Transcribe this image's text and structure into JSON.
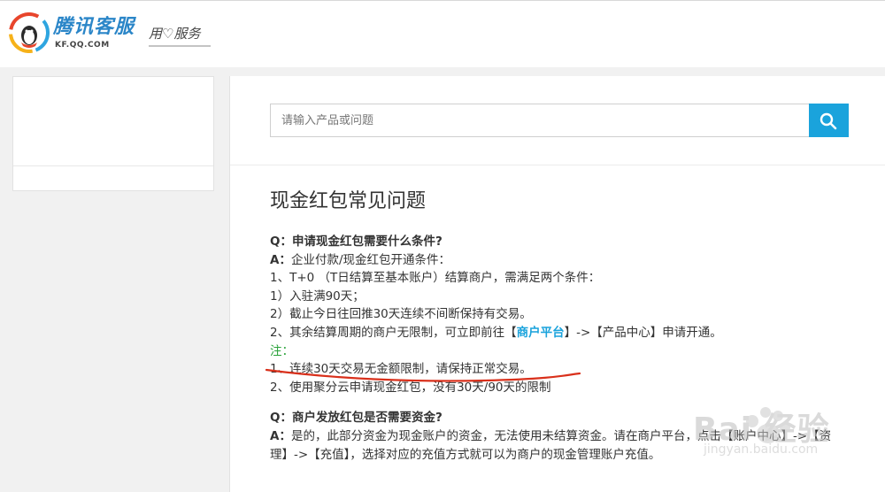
{
  "header": {
    "brand_name": "腾讯客服",
    "brand_url": "KF.QQ.COM",
    "slogan": "用♡服务",
    "logo_colors": [
      "#e8452c",
      "#2ea5e0",
      "#f6b21a",
      "#4fb848"
    ]
  },
  "search": {
    "placeholder": "请输入产品或问题",
    "button_icon": "search-icon",
    "button_color": "#1aa3dc"
  },
  "article": {
    "title": "现金红包常见问题",
    "faq1": {
      "question": "Q：申请现金红包需要什么条件?",
      "answer_label": "A：",
      "answer_intro": "企业付款/现金红包开通条件：",
      "lines": [
        "1、T+0 （T日结算至基本账户）结算商户，需满足两个条件：",
        "1）入驻满90天；",
        "2）截止今日往回推30天连续不间断保持有交易。"
      ],
      "line_prefix": "2、其余结算周期的商户无限制，可立即前往【",
      "link_text": "商户平台",
      "line_suffix": "】->【产品中心】申请开通。",
      "note_label": "注：",
      "notes": [
        "1、连续30天交易无金额限制，请保持正常交易。",
        "2、使用聚分云申请现金红包，没有30天/90天的限制"
      ]
    },
    "faq2": {
      "question": "Q：商户发放红包是否需要资金?",
      "answer_label": "A：",
      "answer_line1": "是的，此部分资金为现金账户的资金，无法使用未结算资金。请在商户平台，点击【账户中心】->【资",
      "answer_line2": "理】->【充值】，选择对应的充值方式就可以为商户的现金管理账户充值。"
    }
  },
  "watermark": {
    "text": "Bai 经验",
    "url": "jingyan.baidu.com"
  },
  "colors": {
    "link": "#1aa3dc",
    "note": "#2aa23a",
    "annotation": "#d9301b"
  }
}
